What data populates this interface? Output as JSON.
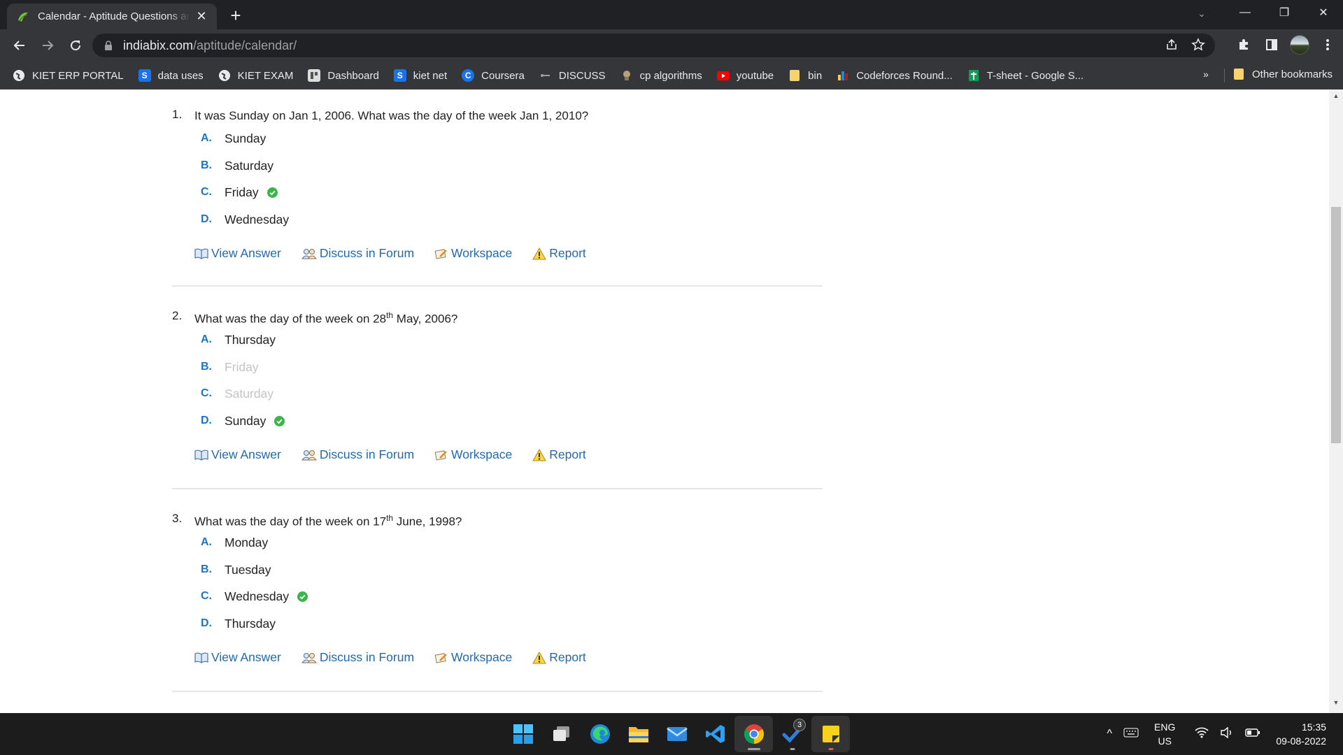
{
  "browser": {
    "tab_title": "Calendar - Aptitude Questions and Answers",
    "new_tab_label": "+",
    "url_host": "indiabix.com",
    "url_path": "/aptitude/calendar/",
    "window_controls": {
      "search": "⌄",
      "minimize": "—",
      "restore": "❐",
      "close": "✕"
    }
  },
  "bookmarks": [
    {
      "label": "KIET ERP PORTAL",
      "icon": "globe-icon",
      "color": "#e8eaed"
    },
    {
      "label": "data uses",
      "icon": "s-logo-icon",
      "color": "#1a73e8"
    },
    {
      "label": "KIET EXAM",
      "icon": "globe-icon",
      "color": "#e8eaed"
    },
    {
      "label": "Dashboard",
      "icon": "dashboard-icon",
      "color": "#dddddd"
    },
    {
      "label": "kiet net",
      "icon": "s-logo-icon",
      "color": "#1a73e8"
    },
    {
      "label": "Coursera",
      "icon": "coursera-icon",
      "color": "#1a73e8"
    },
    {
      "label": "DISCUSS",
      "icon": "discuss-icon",
      "color": "#9aa0a6"
    },
    {
      "label": "cp algorithms",
      "icon": "cp-algorithms-icon",
      "color": "#9c8a6a"
    },
    {
      "label": "youtube",
      "icon": "youtube-icon",
      "color": "#ff0000"
    },
    {
      "label": "bin",
      "icon": "folder-icon",
      "color": "#f6d36b"
    },
    {
      "label": "Codeforces Round...",
      "icon": "codeforces-icon",
      "color": "#1f8acb"
    },
    {
      "label": "T-sheet - Google S...",
      "icon": "sheets-icon",
      "color": "#0f9d58"
    }
  ],
  "bookmarks_more": "»",
  "other_bookmarks": "Other bookmarks",
  "questions": [
    {
      "number": "1.",
      "text": "It was Sunday on Jan 1, 2006. What was the day of the week Jan 1, 2010?",
      "options": [
        {
          "letter": "A.",
          "text": "Sunday"
        },
        {
          "letter": "B.",
          "text": "Saturday"
        },
        {
          "letter": "C.",
          "text": "Friday"
        },
        {
          "letter": "D.",
          "text": "Wednesday"
        }
      ],
      "correct": "C."
    },
    {
      "number": "2.",
      "text_before": "What was the day of the week on 28",
      "sup": "th",
      "text_after": " May, 2006?",
      "options": [
        {
          "letter": "A.",
          "text": "Thursday"
        },
        {
          "letter": "B.",
          "text": "Friday"
        },
        {
          "letter": "C.",
          "text": "Saturday"
        },
        {
          "letter": "D.",
          "text": "Sunday"
        }
      ],
      "correct": "D.",
      "struck_out": [
        "B.",
        "C."
      ]
    },
    {
      "number": "3.",
      "text_before": "What was the day of the week on 17",
      "sup": "th",
      "text_after": " June, 1998?",
      "options": [
        {
          "letter": "A.",
          "text": "Monday"
        },
        {
          "letter": "B.",
          "text": "Tuesday"
        },
        {
          "letter": "C.",
          "text": "Wednesday"
        },
        {
          "letter": "D.",
          "text": "Thursday"
        }
      ],
      "correct": "C."
    }
  ],
  "actions": {
    "view_answer": "View Answer",
    "discuss": "Discuss in Forum",
    "workspace": "Workspace",
    "report": "Report"
  },
  "colors": {
    "option_letter": "#1a76c2",
    "link": "#1f6ab0",
    "correct_check": "#3bb54a",
    "struck_text": "#c4c4c4"
  },
  "taskbar": {
    "apps": [
      "start-icon",
      "task-view-icon",
      "edge-icon",
      "file-explorer-icon",
      "mail-icon",
      "vscode-icon",
      "chrome-icon",
      "todo-icon",
      "sticky-notes-icon"
    ],
    "todo_badge": "3",
    "lang_top": "ENG",
    "lang_bottom": "US",
    "time": "15:35",
    "date": "09-08-2022"
  }
}
